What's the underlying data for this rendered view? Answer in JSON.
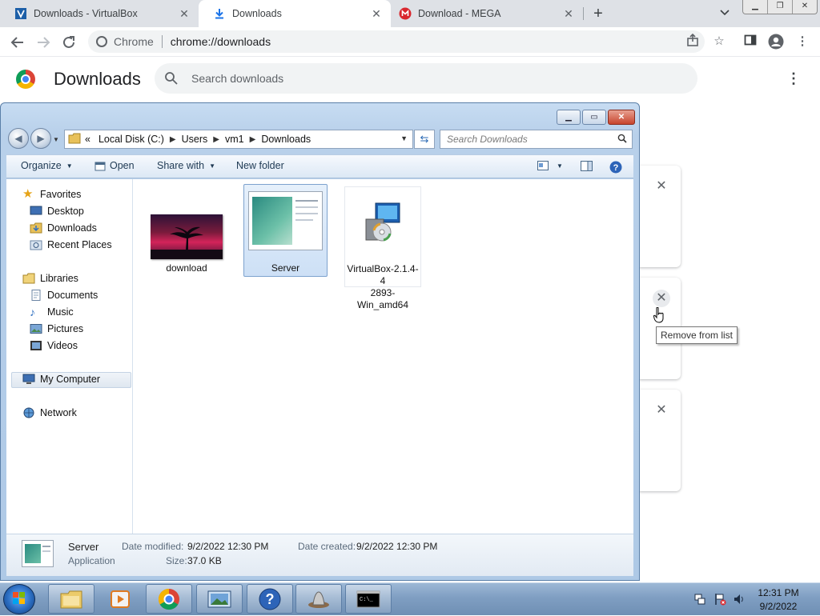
{
  "chrome": {
    "tabs": [
      {
        "title": "Downloads - VirtualBox",
        "icon": "virtualbox-icon"
      },
      {
        "title": "Downloads",
        "icon": "download-arrow-icon"
      },
      {
        "title": "Download - MEGA",
        "icon": "mega-icon"
      }
    ],
    "omnibox": {
      "site_label": "Chrome",
      "url": "chrome://downloads"
    }
  },
  "downloads_page": {
    "title": "Downloads",
    "search_placeholder": "Search downloads",
    "tooltip": "Remove from list"
  },
  "explorer": {
    "breadcrumb": {
      "prefix": "«",
      "parts": [
        "Local Disk (C:)",
        "Users",
        "vm1",
        "Downloads"
      ]
    },
    "search_placeholder": "Search Downloads",
    "commands": {
      "organize": "Organize",
      "open": "Open",
      "share_with": "Share with",
      "new_folder": "New folder"
    },
    "nav": {
      "favorites": "Favorites",
      "desktop": "Desktop",
      "downloads": "Downloads",
      "recent_places": "Recent Places",
      "libraries": "Libraries",
      "documents": "Documents",
      "music": "Music",
      "pictures": "Pictures",
      "videos": "Videos",
      "my_computer": "My Computer",
      "network": "Network"
    },
    "files": [
      {
        "name": "download"
      },
      {
        "name": "Server"
      },
      {
        "name_line1": "VirtualBox-2.1.4-4",
        "name_line2": "2893-Win_amd64"
      }
    ],
    "details": {
      "name": "Server",
      "type": "Application",
      "date_modified_label": "Date modified:",
      "date_modified": "9/2/2022 12:30 PM",
      "date_created_label": "Date created:",
      "date_created": "9/2/2022 12:30 PM",
      "size_label": "Size:",
      "size": "37.0 KB"
    }
  },
  "taskbar": {
    "time": "12:31 PM",
    "date": "9/2/2022"
  },
  "colors": {
    "chrome_tabstrip": "#dee1e6",
    "explorer_frame": "#b8d0ea",
    "taskbar": "#7f9ec2",
    "selection": "#cde0f6"
  }
}
